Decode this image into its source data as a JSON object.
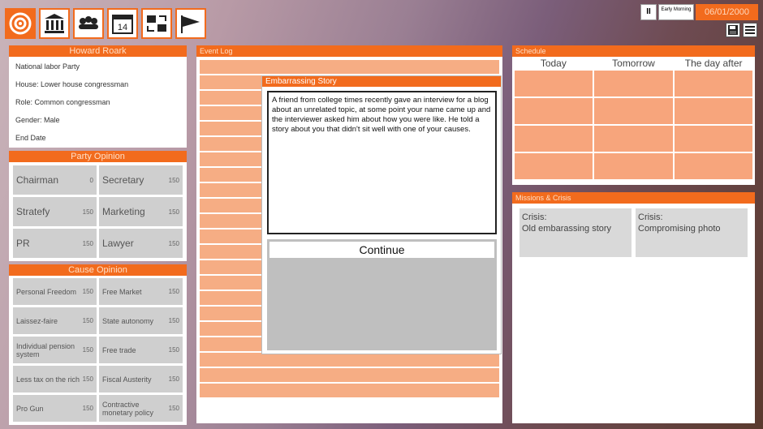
{
  "toolbar": {
    "icons": [
      "target-icon",
      "government-icon",
      "people-icon",
      "calendar-icon",
      "trade-icon",
      "flag-icon"
    ],
    "calendar_day": "14"
  },
  "time": {
    "pause": "II",
    "period": "Early Morning",
    "date": "06/01/2000"
  },
  "politician": {
    "name": "Howard Roark",
    "lines": [
      "National labor Party",
      "House: Lower house congressman",
      "Role: Common congressman",
      "Gender: Male",
      "End Date"
    ]
  },
  "party_opinion": {
    "title": "Party Opinion",
    "items": [
      {
        "label": "Chairman",
        "value": "0"
      },
      {
        "label": "Secretary",
        "value": "150"
      },
      {
        "label": "Stratefy",
        "value": "150"
      },
      {
        "label": "Marketing",
        "value": "150"
      },
      {
        "label": "PR",
        "value": "150"
      },
      {
        "label": "Lawyer",
        "value": "150"
      }
    ]
  },
  "cause_opinion": {
    "title": "Cause Opinion",
    "items": [
      {
        "label": "Personal Freedom",
        "value": "150"
      },
      {
        "label": "Free Market",
        "value": "150"
      },
      {
        "label": "Laissez-faire",
        "value": "150"
      },
      {
        "label": "State autonomy",
        "value": "150"
      },
      {
        "label": "Individual pension system",
        "value": "150"
      },
      {
        "label": "Free trade",
        "value": "150"
      },
      {
        "label": "Less tax on the rich",
        "value": "150"
      },
      {
        "label": "Fiscal Austerity",
        "value": "150"
      },
      {
        "label": "Pro Gun",
        "value": "150"
      },
      {
        "label": "Contractive monetary policy",
        "value": "150"
      }
    ]
  },
  "event_log": {
    "title": "Event Log"
  },
  "dialog": {
    "title": "Embarrassing Story",
    "text": "A friend from college times recently gave an interview for a blog about an unrelated topic, at some point your name came up and the interviewer asked him about how you were like. He told a story about you that didn't sit well with one of your causes.",
    "continue": "Continue"
  },
  "schedule": {
    "title": "Schedule",
    "columns": [
      "Today",
      "Tomorrow",
      "The day after"
    ]
  },
  "missions": {
    "title": "Missions & Crisis",
    "items": [
      {
        "kind": "Crisis:",
        "name": "Old embarassing story"
      },
      {
        "kind": "Crisis:",
        "name": "Compromising photo"
      }
    ]
  }
}
